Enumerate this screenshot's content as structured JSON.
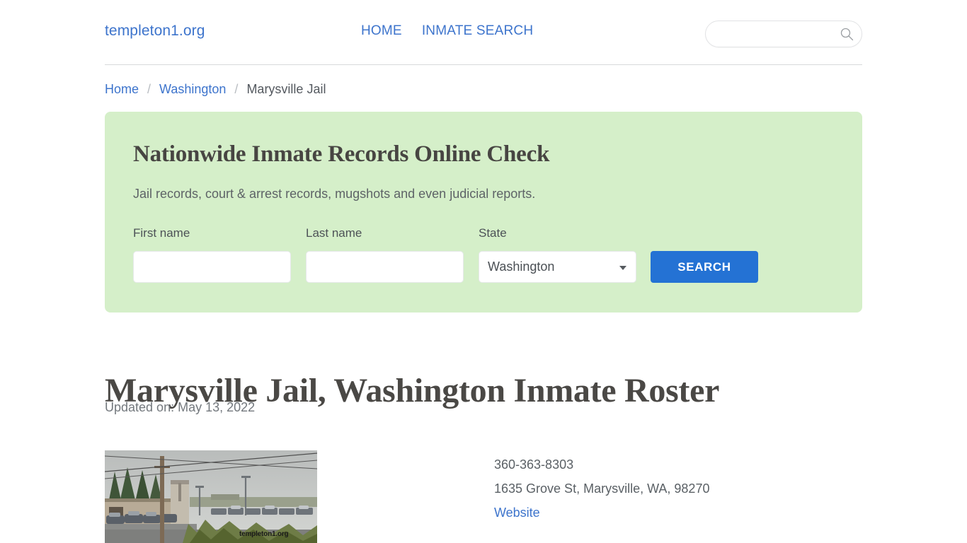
{
  "header": {
    "logo": "templeton1.org",
    "nav": [
      {
        "label": "HOME"
      },
      {
        "label": "INMATE SEARCH"
      }
    ],
    "search": {
      "value": "",
      "placeholder": "",
      "icon": "search-icon"
    }
  },
  "breadcrumb": {
    "home": "Home",
    "sep1": "/",
    "state": "Washington",
    "sep2": "/",
    "current": "Marysville Jail"
  },
  "panel": {
    "title": "Nationwide Inmate Records Online Check",
    "subtitle": "Jail records, court & arrest records, mugshots and even judicial reports.",
    "first_name_label": "First name",
    "first_name_value": "",
    "first_name_placeholder": "",
    "last_name_label": "Last name",
    "last_name_value": "",
    "last_name_placeholder": "",
    "state_label": "State",
    "state_value": "Washington",
    "state_options": [
      "Washington"
    ],
    "search_button": "SEARCH",
    "background_color": "#d5efc9",
    "button_color": "#2472d4"
  },
  "main": {
    "title": "Marysville Jail, Washington Inmate Roster",
    "updated": "Updated on: May 13, 2022",
    "photo": {
      "alt": "Marysville Jail exterior street view",
      "watermark": "templeton1.org"
    },
    "contact": {
      "phone": "360-363-8303",
      "address": "1635 Grove St, Marysville, WA, 98270",
      "website_label": "Website"
    }
  },
  "colors": {
    "link": "#3d74cc",
    "text": "#5a6065",
    "heading": "#4a4845"
  }
}
